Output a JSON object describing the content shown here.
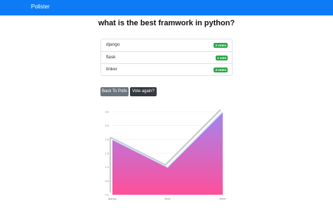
{
  "navbar": {
    "brand": "Pollster"
  },
  "poll": {
    "question": "what is the best framwork in python?",
    "choices": [
      {
        "label": "django",
        "votes": "2 votes"
      },
      {
        "label": "flask",
        "votes": "1 vote"
      },
      {
        "label": "tinker",
        "votes": "3 votes"
      }
    ]
  },
  "actions": {
    "back_label": "Back To Polls",
    "vote_label": "Vote again?"
  },
  "colors": {
    "navbar": "#0d7bf6",
    "badge": "#28a745",
    "gradient_top": "#a385f0",
    "gradient_bottom": "#ff4f9a"
  },
  "chart_data": {
    "type": "area",
    "categories": [
      "django",
      "flask",
      "tinker"
    ],
    "values": [
      2,
      1,
      3
    ],
    "ylim": [
      0,
      3
    ],
    "yticks": [
      "0.0",
      "0.5",
      "1.0",
      "1.5",
      "2.0",
      "2.5",
      "3.0"
    ]
  }
}
